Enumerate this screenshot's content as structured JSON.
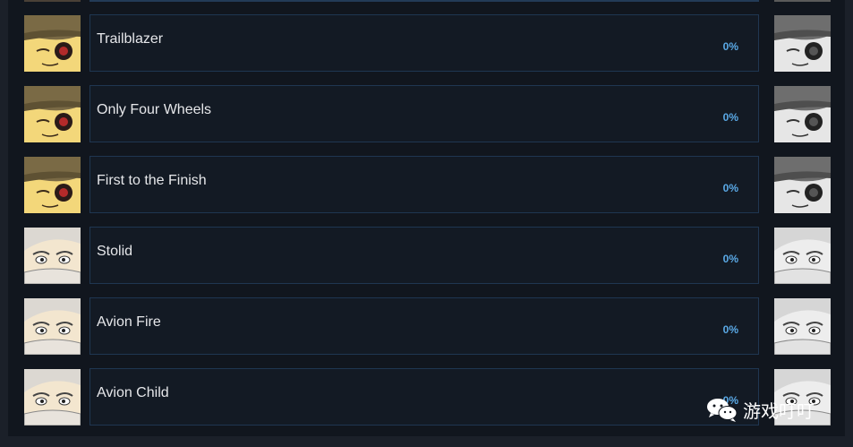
{
  "achievements": [
    {
      "title": "Trailblazer",
      "percent": "0%",
      "icon": "hat-character-portrait"
    },
    {
      "title": "Only Four Wheels",
      "percent": "0%",
      "icon": "hat-character-portrait"
    },
    {
      "title": "First to the Finish",
      "percent": "0%",
      "icon": "hat-character-portrait"
    },
    {
      "title": "Stolid",
      "percent": "0%",
      "icon": "old-man-portrait"
    },
    {
      "title": "Avion Fire",
      "percent": "0%",
      "icon": "old-man-portrait"
    },
    {
      "title": "Avion Child",
      "percent": "0%",
      "icon": "old-man-portrait"
    }
  ],
  "watermark": {
    "text": "游戏叮叮",
    "icon": "wechat-icon"
  },
  "colors": {
    "background": "#11161e",
    "row_border": "#1f3651",
    "title_text": "#e6e7ea",
    "percent_text": "#5aa9e6"
  }
}
